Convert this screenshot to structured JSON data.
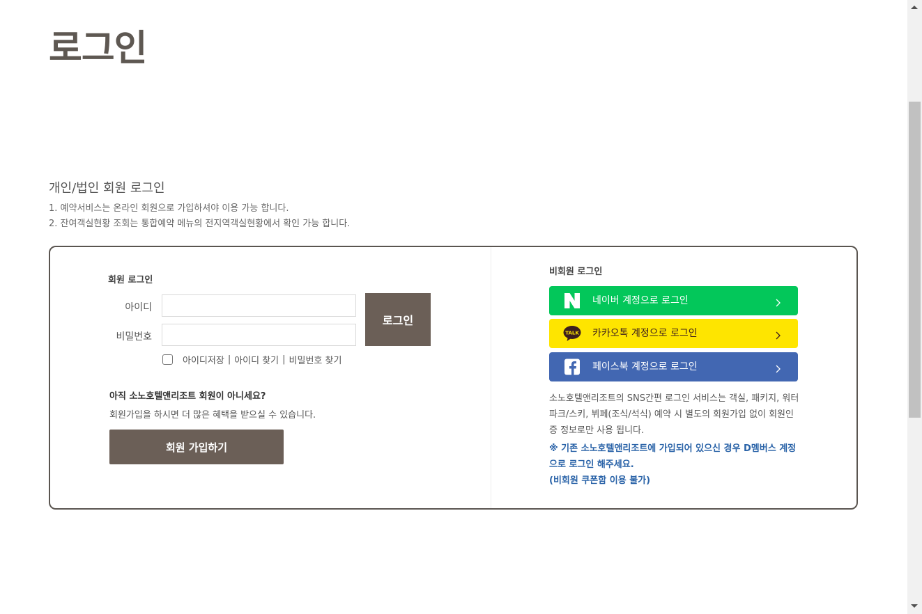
{
  "page": {
    "title": "로그인"
  },
  "section": {
    "title": "개인/법인 회원 로그인",
    "notices": [
      "1. 예약서비스는 온라인 회원으로 가입하셔야 이용 가능 합니다.",
      "2. 잔여객실현황 조회는 통합예약 메뉴의 전지역객실현황에서 확인 가능 합니다."
    ]
  },
  "member_login": {
    "title": "회원 로그인",
    "id_label": "아이디",
    "id_value": "",
    "password_label": "비밀번호",
    "password_value": "",
    "login_button": "로그인",
    "remember_checked": false,
    "links": {
      "save_id": "아이디저장",
      "find_id": "아이디 찾기",
      "find_password": "비밀번호 찾기",
      "separator": "|"
    }
  },
  "signup": {
    "question": "아직 소노호텔앤리조트 회원이 아니세요?",
    "description": "회원가입을 하시면 더 많은 혜택을 받으실 수 있습니다.",
    "button": "회원 가입하기"
  },
  "guest_login": {
    "title": "비회원 로그인",
    "sns": [
      {
        "label": "네이버 계정으로 로그인",
        "icon": "naver-n-icon",
        "color": "#03c75a"
      },
      {
        "label": "카카오톡 계정으로 로그인",
        "icon": "kakaotalk-icon",
        "color": "#fee500"
      },
      {
        "label": "페이스북 계정으로 로그인",
        "icon": "facebook-icon",
        "color": "#4267b2"
      }
    ],
    "description": "소노호텔앤리조트의 SNS간편 로그인 서비스는 객실, 패키지, 워터파크/스키, 뷔페(조식/석식) 예약 시 별도의 회원가입 없이 회원인증 정보로만 사용 됩니다.",
    "note_line1": "※ 기존 소노호텔앤리조트에 가입되어 있으신 경우 D멤버스 계정으로 로그인 해주세요.",
    "note_line2": "(비회원 쿠폰함 이용 불가)"
  },
  "colors": {
    "brand_brown": "#6b5f57",
    "title_brown": "#5e5852",
    "note_blue": "#2a63a8"
  }
}
